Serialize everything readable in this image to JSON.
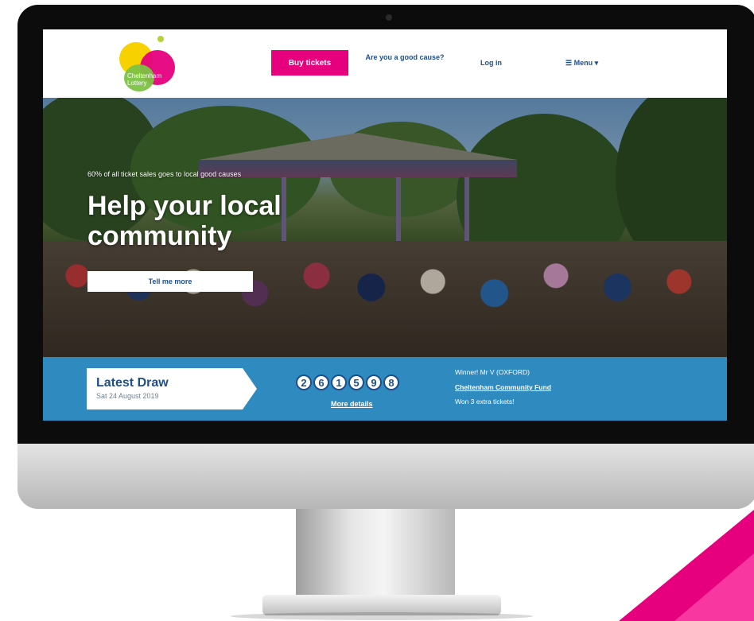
{
  "header": {
    "logo_text": "Cheltenham Lottery",
    "buy_tickets": "Buy tickets",
    "good_cause": "Are you a good cause?",
    "login": "Log in",
    "menu": "☰ Menu ▾"
  },
  "hero": {
    "tagline": "60% of all ticket sales goes to local good causes",
    "title": "Help your local community",
    "cta": "Tell me more"
  },
  "draw": {
    "title": "Latest Draw",
    "date": "Sat 24 August 2019",
    "numbers": [
      "2",
      "6",
      "1",
      "5",
      "9",
      "8"
    ],
    "more_details": "More details",
    "winner": "Winner! Mr V (OXFORD)",
    "cause": "Cheltenham Community Fund",
    "prize": "Won 3 extra tickets!"
  },
  "colors": {
    "brand_pink": "#e6007e",
    "brand_blue": "#2f8ac0",
    "navy": "#1e4f8c"
  }
}
